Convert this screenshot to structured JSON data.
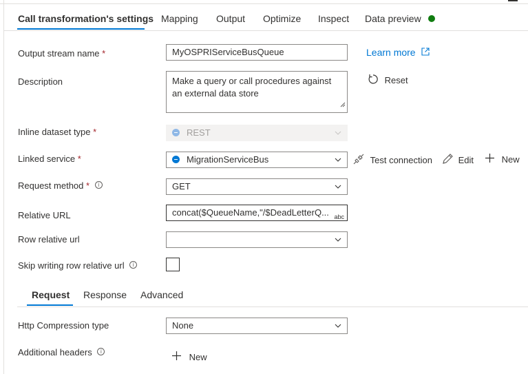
{
  "tabs": [
    {
      "label": "Call transformation's settings",
      "active": true
    },
    {
      "label": "Mapping"
    },
    {
      "label": "Output"
    },
    {
      "label": "Optimize"
    },
    {
      "label": "Inspect"
    },
    {
      "label": "Data preview",
      "status_color": "#107c10"
    }
  ],
  "form": {
    "output_stream": {
      "label": "Output stream name",
      "required": "*",
      "value": "MyOSPRIServiceBusQueue"
    },
    "learn_more": "Learn more",
    "description": {
      "label": "Description",
      "value": "Make a query or call procedures against an external data store"
    },
    "reset": "Reset",
    "inline_dataset": {
      "label": "Inline dataset type",
      "required": "*",
      "value": "REST"
    },
    "linked_service": {
      "label": "Linked service",
      "required": "*",
      "value": "MigrationServiceBus"
    },
    "test_connection": "Test connection",
    "edit": "Edit",
    "new": "New",
    "request_method": {
      "label": "Request method",
      "required": "*",
      "info": "i",
      "value": "GET"
    },
    "relative_url": {
      "label": "Relative URL",
      "value": "concat($QueueName,\"/$DeadLetterQ...",
      "badge": "abc"
    },
    "row_relative_url": {
      "label": "Row relative url",
      "value": ""
    },
    "skip_row_url": {
      "label": "Skip writing row relative url",
      "info": "i",
      "checked": false
    }
  },
  "subtabs": [
    {
      "label": "Request",
      "active": true
    },
    {
      "label": "Response"
    },
    {
      "label": "Advanced"
    }
  ],
  "request": {
    "compression": {
      "label": "Http Compression type",
      "value": "None"
    },
    "headers": {
      "label": "Additional headers",
      "info": "i",
      "new": "New"
    }
  },
  "colors": {
    "accent": "#0078d4",
    "required": "#a4262c",
    "status_ok": "#107c10"
  }
}
